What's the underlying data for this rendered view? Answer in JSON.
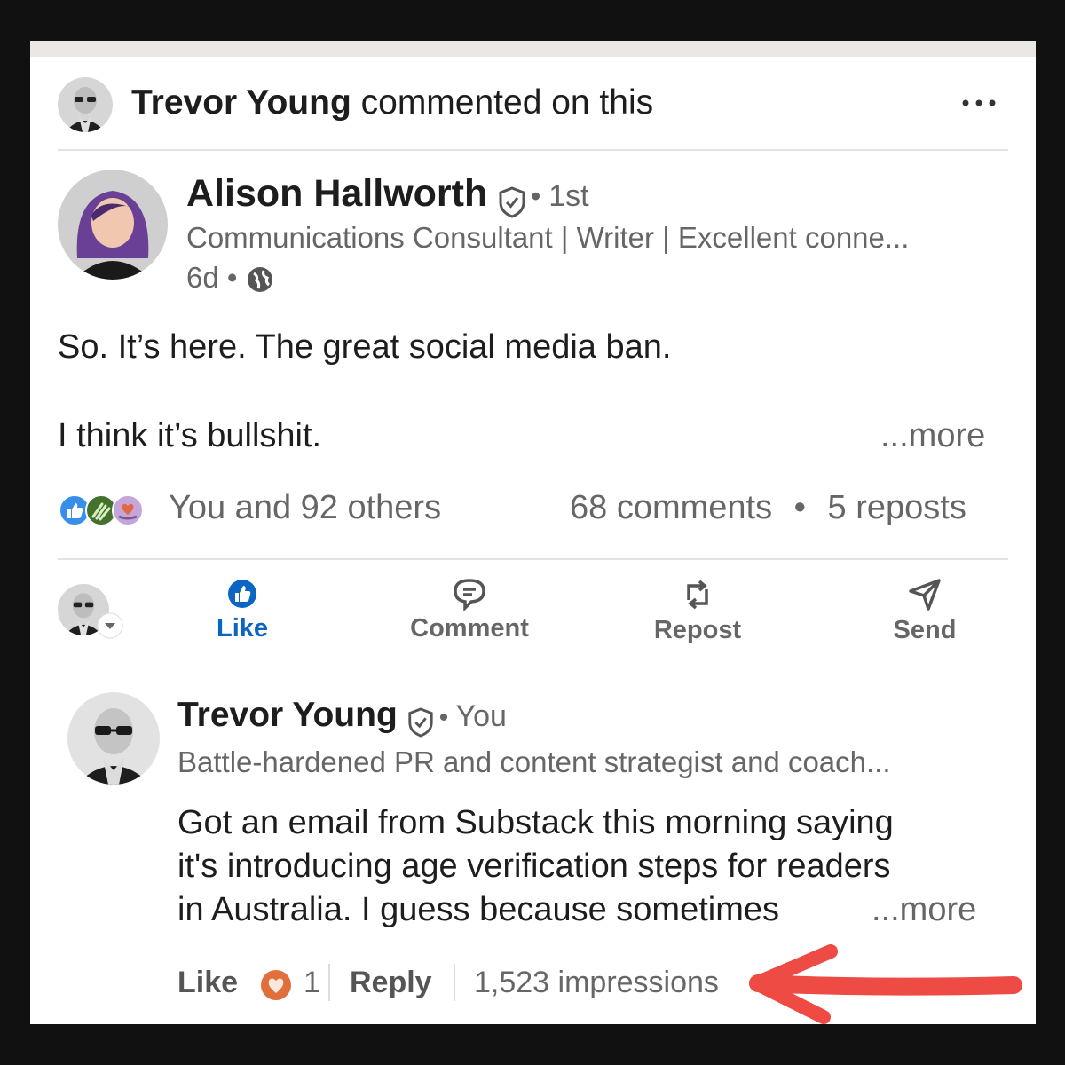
{
  "activity": {
    "actor_name": "Trevor Young",
    "action_text": "commented on this",
    "menu_icon": "more-horizontal-icon"
  },
  "post": {
    "author_name": "Alison Hallworth",
    "verified_icon": "verified-shield-icon",
    "degree": "1st",
    "headline": "Communications Consultant | Writer | Excellent conne...",
    "age": "6d",
    "visibility_icon": "globe-icon",
    "text_line1": "So.  It’s here. The great social media ban.",
    "text_line2": "I think it’s bullshit.",
    "more_label": "...more"
  },
  "social_counts": {
    "reaction_icons": [
      "like-reaction-icon",
      "celebrate-reaction-icon",
      "support-reaction-icon"
    ],
    "reactions_text": "You and 92 others",
    "comments_text": "68 comments",
    "separator": "•",
    "reposts_text": "5 reposts"
  },
  "actions": {
    "like": "Like",
    "comment": "Comment",
    "repost": "Repost",
    "send": "Send"
  },
  "comment": {
    "author_name": "Trevor Young",
    "relation": "You",
    "headline": "Battle-hardened PR and content strategist and coach...",
    "text_line1": "Got an email from Substack this morning saying",
    "text_line2": "it's introducing age verification steps for readers",
    "text_line3": "in Australia. I guess because sometimes",
    "more_label": "...more",
    "like_label": "Like",
    "reaction_count": "1",
    "reply_label": "Reply",
    "impressions": "1,523 impressions"
  },
  "colors": {
    "linkedin_blue": "#0a66c2",
    "text_dark": "#1d1d1d",
    "text_gray": "#666666",
    "annotation_arrow": "#ef4b45",
    "love_reaction": "#e06f3c"
  }
}
